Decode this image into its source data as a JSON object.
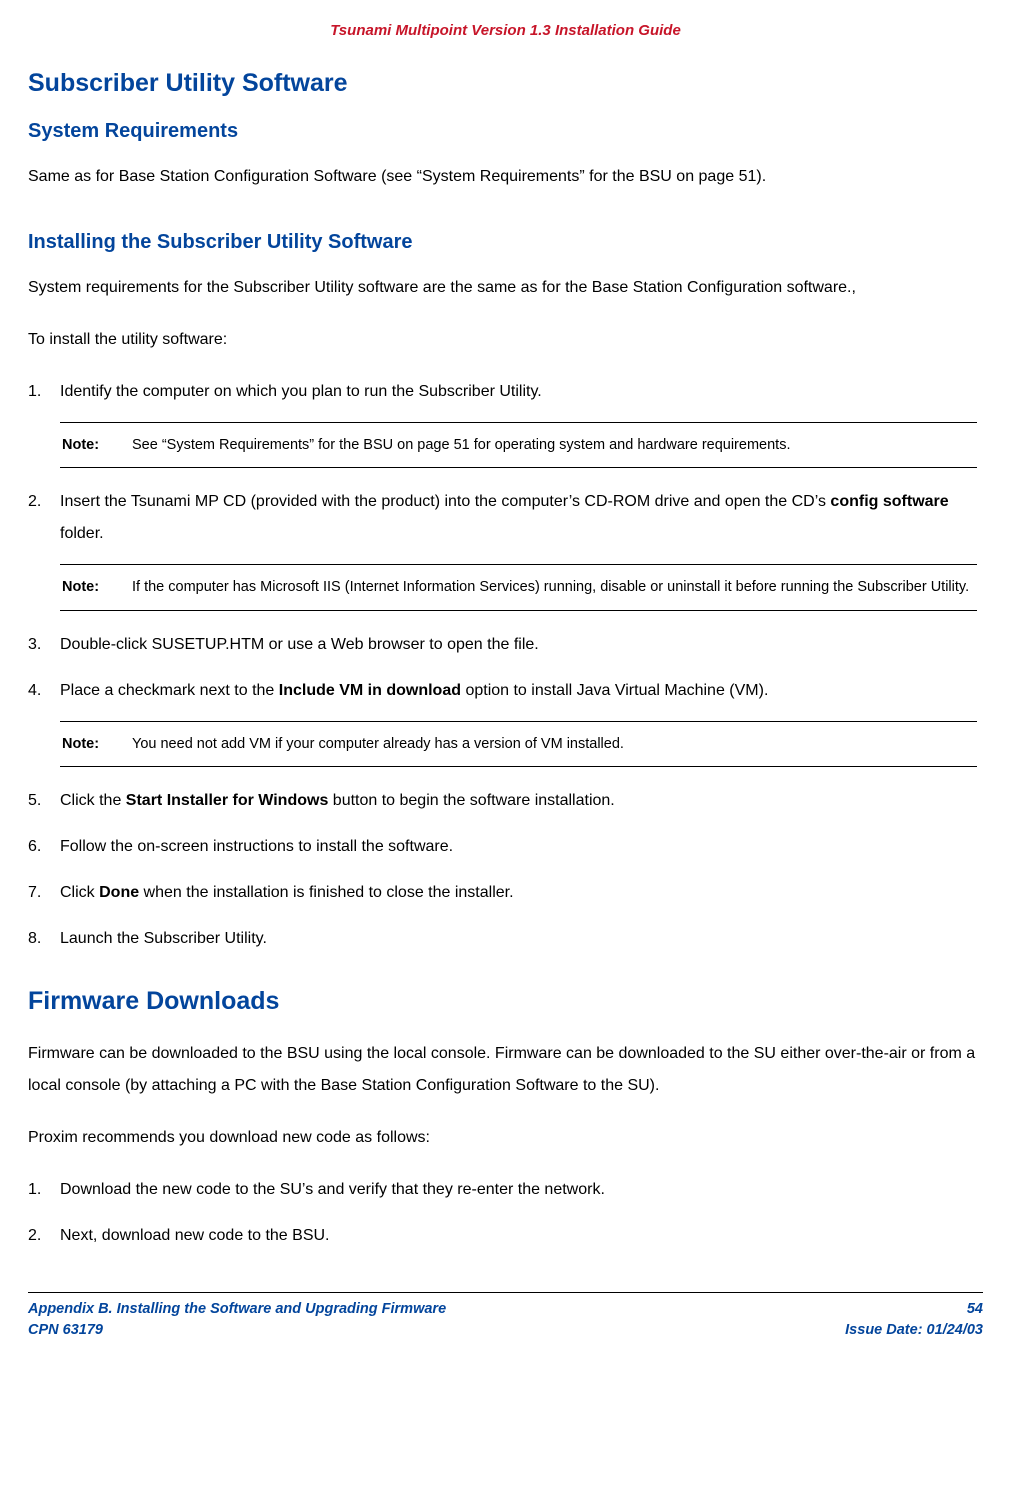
{
  "header": "Tsunami Multipoint Version 1.3 Installation Guide",
  "sec1": {
    "title": "Subscriber Utility Software",
    "sub1": {
      "title": "System Requirements",
      "p1": "Same as for Base Station Configuration Software (see “System Requirements” for the BSU on page 51)."
    },
    "sub2": {
      "title": "Installing the Subscriber Utility Software",
      "p1": "System requirements for the Subscriber Utility software are the same as for the Base Station Configuration software.,",
      "p2": "To install the utility software:",
      "li1_num": "1.",
      "li1": "Identify the computer on which you plan to run the Subscriber Utility.",
      "note1_label": "Note:",
      "note1": "See “System Requirements” for the BSU on page 51 for operating system and hardware requirements.",
      "li2_num": "2.",
      "li2_a": "Insert the Tsunami MP CD (provided with the product) into the computer’s CD-ROM drive and open the CD’s ",
      "li2_b": "config software",
      "li2_c": " folder.",
      "note2_label": "Note:",
      "note2": "If the computer has Microsoft IIS (Internet Information Services) running, disable or uninstall it before running the Subscriber Utility.",
      "li3_num": "3.",
      "li3": "Double-click SUSETUP.HTM or use a Web browser to open the file.",
      "li4_num": "4.",
      "li4_a": "Place a checkmark next to the ",
      "li4_b": "Include VM in download",
      "li4_c": " option to install Java Virtual Machine (VM).",
      "note3_label": "Note:",
      "note3": "You need not add VM if your computer already has a version of VM installed.",
      "li5_num": "5.",
      "li5_a": "Click the ",
      "li5_b": "Start Installer for Windows",
      "li5_c": " button to begin the software installation.",
      "li6_num": "6.",
      "li6": "Follow the on-screen instructions to install the software.",
      "li7_num": "7.",
      "li7_a": "Click ",
      "li7_b": "Done",
      "li7_c": " when the installation is finished to close the installer.",
      "li8_num": "8.",
      "li8": "Launch the Subscriber Utility."
    }
  },
  "sec2": {
    "title": "Firmware Downloads",
    "p1": "Firmware can be downloaded to the BSU using the local console.  Firmware can be downloaded to the SU either over-the-air or from a local console (by attaching a PC with the Base Station Configuration Software to the SU).",
    "p2": "Proxim recommends you download new code as follows:",
    "li1_num": "1.",
    "li1": "Download the new code to the SU’s and verify that they re-enter the network.",
    "li2_num": "2.",
    "li2": "Next, download new code to the BSU."
  },
  "footer": {
    "left1": "Appendix B. Installing the Software and Upgrading Firmware",
    "left2": "CPN 63179",
    "right1": "54",
    "right2": "Issue Date:  01/24/03"
  }
}
